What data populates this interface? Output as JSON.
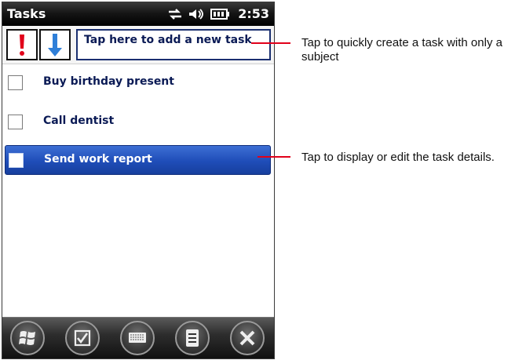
{
  "statusbar": {
    "app_title": "Tasks",
    "time": "2:53"
  },
  "quickbar": {
    "add_task_placeholder": "Tap here to add a new task"
  },
  "tasks": [
    {
      "label": "Buy birthday present",
      "checked": false,
      "selected": false
    },
    {
      "label": "Call dentist",
      "checked": false,
      "selected": false
    },
    {
      "label": "Send work report",
      "checked": false,
      "selected": true
    }
  ],
  "softkeys": [
    "windows-start-icon",
    "checkmark-box-icon",
    "keyboard-icon",
    "menu-icon",
    "close-icon"
  ],
  "callouts": {
    "add_task": "Tap to quickly create a task with only a subject",
    "task_details": "Tap to display or edit the task details."
  },
  "colors": {
    "accent": "#e1001a",
    "selection": "#2a56c2"
  }
}
